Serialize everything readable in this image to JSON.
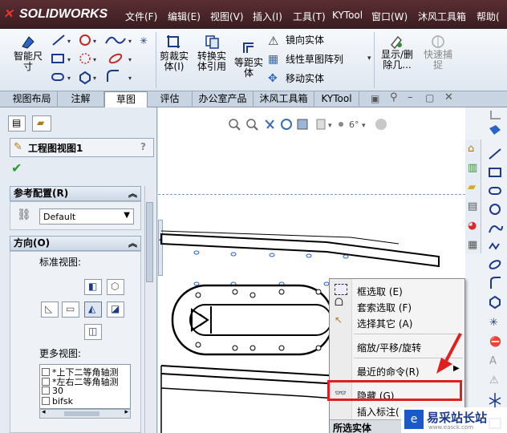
{
  "app": {
    "name": "SOLIDWORKS"
  },
  "menu": {
    "items": [
      "文件(F)",
      "编辑(E)",
      "视图(V)",
      "插入(I)",
      "工具(T)",
      "KYTool",
      "窗口(W)",
      "沐风工具箱",
      "帮助("
    ]
  },
  "ribbon": {
    "smart_dimension": "智能尺\n寸",
    "crop_view": "剪裁实\n体(I)",
    "convert_ref": "转换实\n体引用",
    "offset": "等距实\n体",
    "mirror": "镜向实体",
    "linear_pattern": "线性草图阵列",
    "move": "移动实体",
    "show_delete": "显示/删\n除几...",
    "quick_snap": "快速捕\n捉"
  },
  "tabs": [
    "视图布局",
    "注解",
    "草图",
    "评估",
    "办公室产品",
    "沐风工具箱",
    "KYTool"
  ],
  "active_tab": "草图",
  "left_panel": {
    "title": "工程图视图1",
    "help": "?",
    "ref_config": {
      "title": "参考配置(R)",
      "value": "Default"
    },
    "orientation": {
      "title": "方向(O)",
      "std_views": "标准视图:",
      "more_views": "更多视图:",
      "list": [
        "*上下二等角轴测",
        "*左右二等角轴测",
        "30",
        "bifsk"
      ]
    }
  },
  "context_menu": {
    "items": [
      {
        "label": "框选取 (E)"
      },
      {
        "label": "套索选取 (F)"
      },
      {
        "label": "选择其它 (A)"
      },
      {
        "label": "缩放/平移/旋转"
      },
      {
        "label": "最近的命令(R)"
      },
      {
        "label": "隐藏 (G)"
      },
      {
        "label": "插入标注("
      },
      {
        "label": "所选实体"
      }
    ],
    "highlight_color": "#e02020"
  },
  "watermark": {
    "text": "易采站长站",
    "sub": "www.easck.com"
  }
}
